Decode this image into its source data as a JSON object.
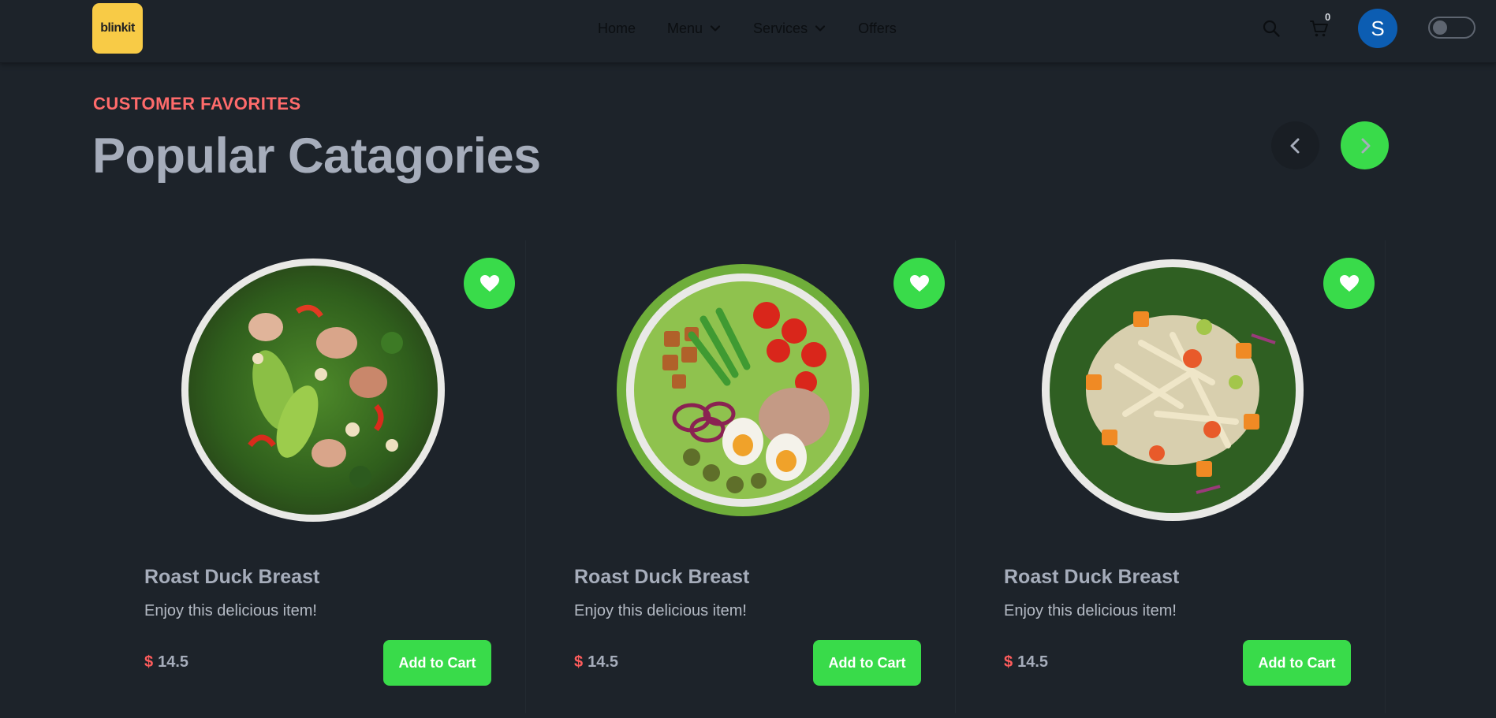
{
  "header": {
    "logo_text": "blinkit",
    "nav": [
      {
        "label": "Home",
        "has_dropdown": false
      },
      {
        "label": "Menu",
        "has_dropdown": true
      },
      {
        "label": "Services",
        "has_dropdown": true
      },
      {
        "label": "Offers",
        "has_dropdown": false
      }
    ],
    "cart_count": "0",
    "avatar_initial": "S",
    "theme_toggle_on": false
  },
  "section": {
    "eyebrow": "CUSTOMER FAVORITES",
    "title": "Popular Catagories"
  },
  "cards": [
    {
      "title": "Roast Duck Breast",
      "description": "Enjoy this delicious item!",
      "currency": "$",
      "price": "14.5",
      "button": "Add to Cart",
      "image": "chicken-avocado-salad-bowl"
    },
    {
      "title": "Roast Duck Breast",
      "description": "Enjoy this delicious item!",
      "currency": "$",
      "price": "14.5",
      "button": "Add to Cart",
      "image": "nicoise-salad-bowl"
    },
    {
      "title": "Roast Duck Breast",
      "description": "Enjoy this delicious item!",
      "currency": "$",
      "price": "14.5",
      "button": "Add to Cart",
      "image": "chicken-squash-salad-bowl"
    }
  ],
  "colors": {
    "background": "#1d232a",
    "accent_green": "#39db4a",
    "eyebrow_red": "#ff6b6b",
    "avatar_blue": "#0c5db2",
    "logo_yellow": "#f8cb46"
  }
}
